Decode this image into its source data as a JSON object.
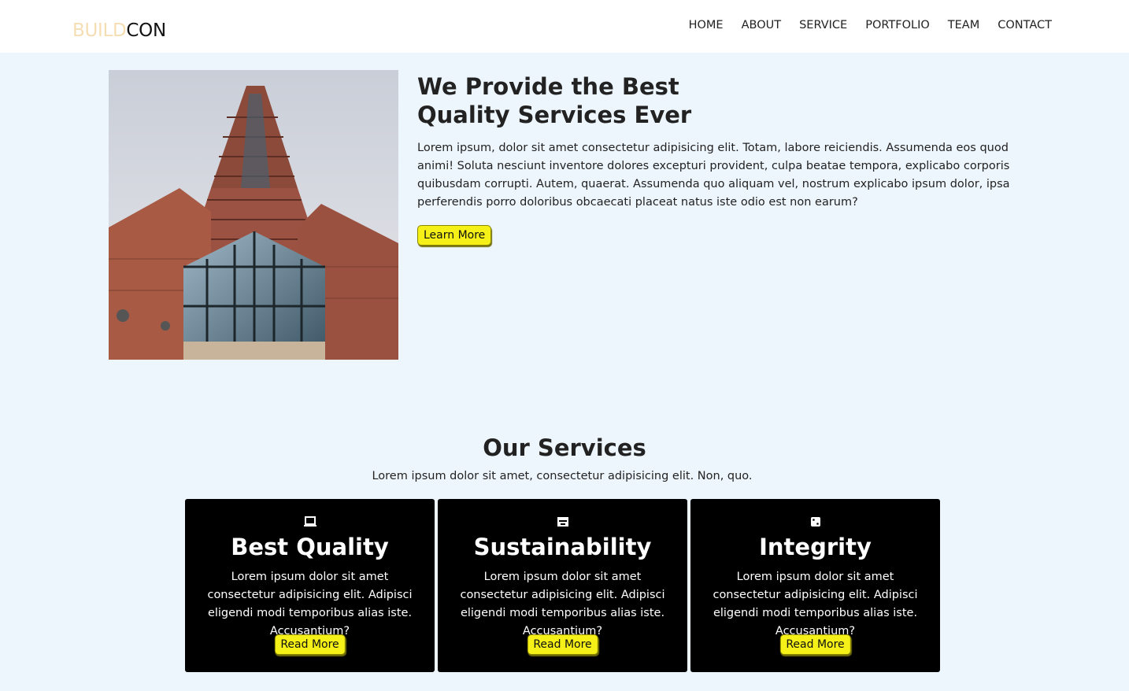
{
  "brand": {
    "part1": "BUILD",
    "part2": "CON"
  },
  "nav": [
    "HOME",
    "ABOUT",
    "SERVICE",
    "PORTFOLIO",
    "TEAM",
    "CONTACT"
  ],
  "hero": {
    "title": "We Provide the Best Quality Services Ever",
    "description": "Lorem ipsum, dolor sit amet consectetur adipisicing elit. Totam, labore reiciendis. Assumenda eos quod animi! Soluta nesciunt inventore dolores excepturi provident, culpa beatae tempora, explicabo corporis quibusdam corrupti. Autem, quaerat. Assumenda quo aliquam vel, nostrum explicabo ipsum dolor, ipsa perferendis porro doloribus obcaecati placeat natus iste odio est non earum?",
    "button": "Learn More"
  },
  "services": {
    "title": "Our Services",
    "subtitle": "Lorem ipsum dolor sit amet, consectetur adipisicing elit. Non, quo.",
    "cards": [
      {
        "icon": "laptop-icon",
        "title": "Best Quality",
        "description": "Lorem ipsum dolor sit amet consectetur adipisicing elit. Adipisci eligendi modi temporibus alias iste. Accusantium?",
        "button": "Read More"
      },
      {
        "icon": "tray-icon",
        "title": "Sustainability",
        "description": "Lorem ipsum dolor sit amet consectetur adipisicing elit. Adipisci eligendi modi temporibus alias iste. Accusantium?",
        "button": "Read More"
      },
      {
        "icon": "dice-icon",
        "title": "Integrity",
        "description": "Lorem ipsum dolor sit amet consectetur adipisicing elit. Adipisci eligendi modi temporibus alias iste. Accusantium?",
        "button": "Read More"
      }
    ]
  },
  "colors": {
    "background": "#eef6fd",
    "button": "#f4f018",
    "card": "#000000",
    "brand_accent": "#f5deb3"
  }
}
